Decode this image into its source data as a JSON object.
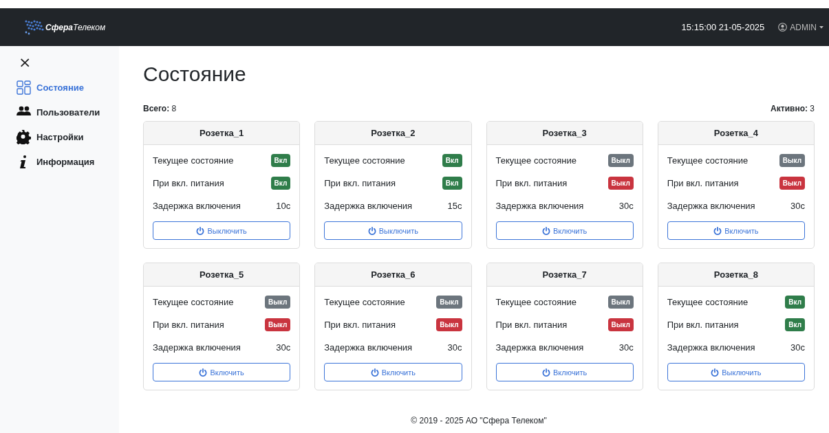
{
  "header": {
    "logo": "Сфера",
    "logo_suffix": "Телеком",
    "datetime": "15:15:00 21-05-2025",
    "user": "ADMIN"
  },
  "sidebar": {
    "close": "×",
    "items": [
      {
        "label": "Состояние",
        "selected": true
      },
      {
        "label": "Пользователи",
        "selected": false
      },
      {
        "label": "Настройки",
        "selected": false
      },
      {
        "label": "Информация",
        "selected": false
      }
    ]
  },
  "page": {
    "title": "Состояние",
    "total_label": "Всего:",
    "total": "8",
    "active_label": "Активно:",
    "active": "3"
  },
  "sockets": [
    {
      "name": "Розетка_1",
      "rows": [
        {
          "kind": "state",
          "label": "Текущее состояние",
          "badge": "Вкл",
          "on": true
        },
        {
          "kind": "power",
          "label": "При вкл. питания",
          "badge": "Вкл",
          "on": true
        },
        {
          "kind": "delay",
          "label": "Задержка включения",
          "value": "10с"
        }
      ],
      "button": "Выключить"
    },
    {
      "name": "Розетка_2",
      "rows": [
        {
          "kind": "state",
          "label": "Текущее состояние",
          "badge": "Вкл",
          "on": true
        },
        {
          "kind": "power",
          "label": "При вкл. питания",
          "badge": "Вкл",
          "on": true
        },
        {
          "kind": "delay",
          "label": "Задержка включения",
          "value": "15с"
        }
      ],
      "button": "Выключить"
    },
    {
      "name": "Розетка_3",
      "rows": [
        {
          "kind": "state",
          "label": "Текущее состояние",
          "badge": "Выкл",
          "on": false
        },
        {
          "kind": "power",
          "label": "При вкл. питания",
          "badge": "Выкл",
          "on": false
        },
        {
          "kind": "delay",
          "label": "Задержка включения",
          "value": "30с"
        }
      ],
      "button": "Включить"
    },
    {
      "name": "Розетка_4",
      "rows": [
        {
          "kind": "state",
          "label": "Текущее состояние",
          "badge": "Выкл",
          "on": false
        },
        {
          "kind": "power",
          "label": "При вкл. питания",
          "badge": "Выкл",
          "on": false
        },
        {
          "kind": "delay",
          "label": "Задержка включения",
          "value": "30с"
        }
      ],
      "button": "Включить"
    },
    {
      "name": "Розетка_5",
      "rows": [
        {
          "kind": "state",
          "label": "Текущее состояние",
          "badge": "Выкл",
          "on": false
        },
        {
          "kind": "power",
          "label": "При вкл. питания",
          "badge": "Выкл",
          "on": false
        },
        {
          "kind": "delay",
          "label": "Задержка включения",
          "value": "30с"
        }
      ],
      "button": "Включить"
    },
    {
      "name": "Розетка_6",
      "rows": [
        {
          "kind": "state",
          "label": "Текущее состояние",
          "badge": "Выкл",
          "on": false
        },
        {
          "kind": "power",
          "label": "При вкл. питания",
          "badge": "Выкл",
          "on": false
        },
        {
          "kind": "delay",
          "label": "Задержка включения",
          "value": "30с"
        }
      ],
      "button": "Включить"
    },
    {
      "name": "Розетка_7",
      "rows": [
        {
          "kind": "state",
          "label": "Текущее состояние",
          "badge": "Выкл",
          "on": false
        },
        {
          "kind": "power",
          "label": "При вкл. питания",
          "badge": "Выкл",
          "on": false
        },
        {
          "kind": "delay",
          "label": "Задержка включения",
          "value": "30с"
        }
      ],
      "button": "Включить"
    },
    {
      "name": "Розетка_8",
      "rows": [
        {
          "kind": "state",
          "label": "Текущее состояние",
          "badge": "Вкл",
          "on": true
        },
        {
          "kind": "power",
          "label": "При вкл. питания",
          "badge": "Вкл",
          "on": true
        },
        {
          "kind": "delay",
          "label": "Задержка включения",
          "value": "30с"
        }
      ],
      "button": "Выключить"
    }
  ],
  "footer": "© 2019 - 2025 АО \"Сфера Телеком\""
}
